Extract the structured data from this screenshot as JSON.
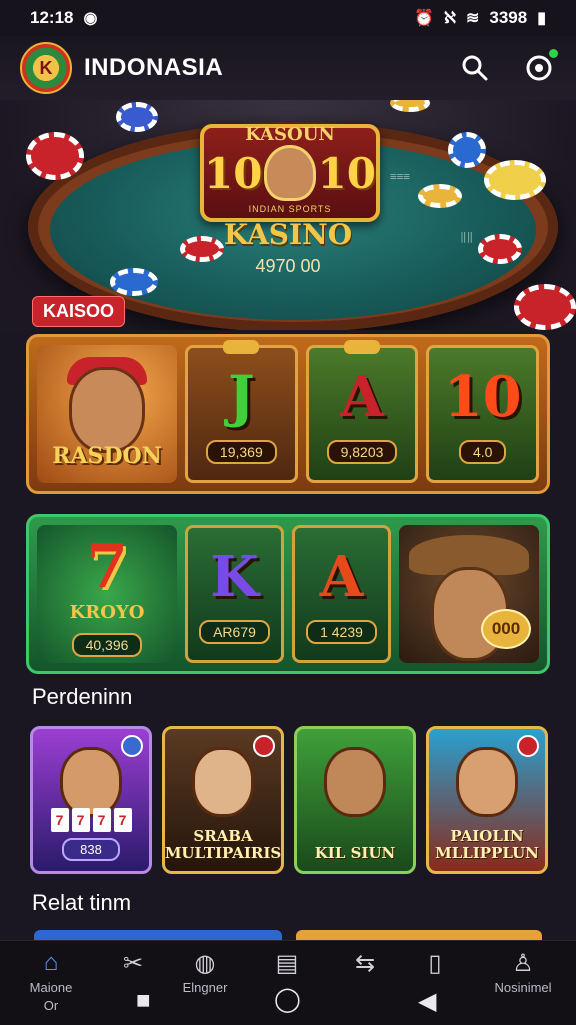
{
  "status_bar": {
    "time": "12:18",
    "battery": "3398"
  },
  "app_bar": {
    "title": "INDONASIA",
    "logo_text": "K"
  },
  "hero": {
    "badge_caption": "KASOUN",
    "badge_left": "10",
    "badge_right": "10",
    "badge_sub": "INDIAN SPORTS",
    "title": "KASINO",
    "amount": "4970 00"
  },
  "section1_label": "KAISOO",
  "row1": {
    "character_name": "RASDON",
    "reels": [
      {
        "symbol": "J",
        "value": "19,369",
        "color": "#3fd03a"
      },
      {
        "symbol": "A",
        "value": "9,8203",
        "color": "#c8232a"
      },
      {
        "symbol": "10",
        "value": "4.0",
        "color": "#ff4a1a"
      }
    ]
  },
  "row2": {
    "logo": "7",
    "logo_text": "KROYO",
    "logo_value": "40,396",
    "reels": [
      {
        "symbol": "K",
        "value": "AR679",
        "color": "#7a4ae6"
      },
      {
        "symbol": "A",
        "value": "1 4239",
        "color": "#e64a1a"
      }
    ],
    "coin": "000"
  },
  "section2_heading": "Perdeninn",
  "games": [
    {
      "title": "",
      "pill": "838",
      "reels": [
        "7",
        "7",
        "7",
        "7"
      ]
    },
    {
      "title": "SRABA MULTIPAIRIS"
    },
    {
      "title": "KIL SIUN"
    },
    {
      "title": "PAIOLIN MLLIPPLUN"
    }
  ],
  "section3_heading": "Relat tinm",
  "nav": {
    "items": [
      {
        "label": "Maione",
        "icon": "home-icon"
      },
      {
        "label": "",
        "icon": "tools-icon"
      },
      {
        "label": "Elngner",
        "icon": "chip-icon"
      },
      {
        "label": "",
        "icon": "message-icon"
      },
      {
        "label": "",
        "icon": "swap-icon"
      },
      {
        "label": "",
        "icon": "phone-icon"
      },
      {
        "label": "Nosinimel",
        "icon": "profile-icon"
      }
    ],
    "home_sub": "Or"
  },
  "colors": {
    "accent": "#c8232a",
    "gold": "#e8b43b",
    "bg": "#1b1722"
  }
}
